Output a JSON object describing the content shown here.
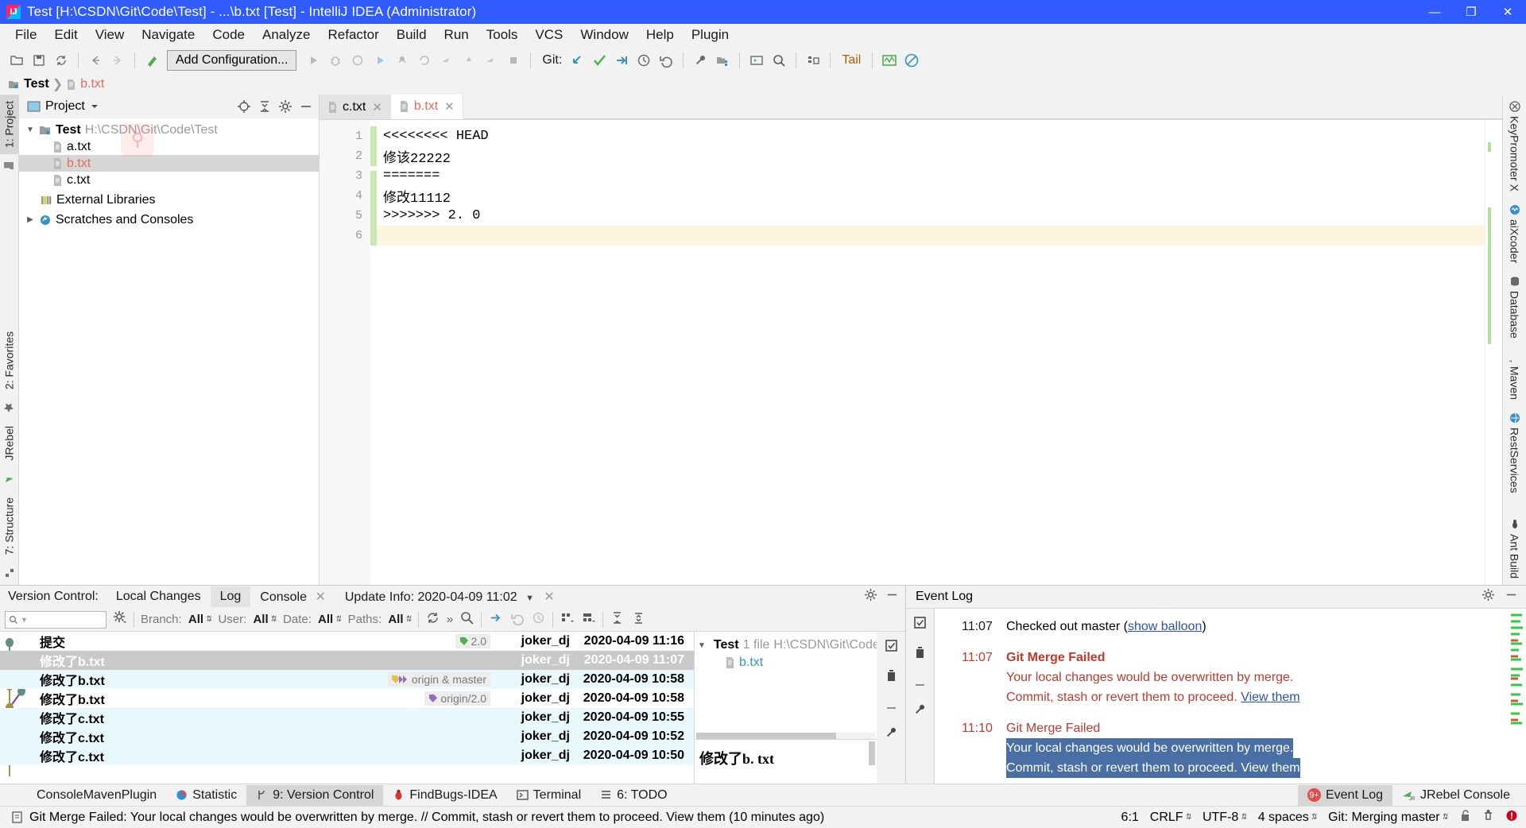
{
  "window": {
    "title": "Test [H:\\CSDN\\Git\\Code\\Test] - ...\\b.txt [Test] - IntelliJ IDEA (Administrator)",
    "minimize": "—",
    "maximize": "❐",
    "close": "✕"
  },
  "menu": [
    "File",
    "Edit",
    "View",
    "Navigate",
    "Code",
    "Analyze",
    "Refactor",
    "Build",
    "Run",
    "Tools",
    "VCS",
    "Window",
    "Help",
    "Plugin"
  ],
  "toolbar": {
    "add_configuration": "Add Configuration...",
    "git_label": "Git:",
    "tail_label": "Tail"
  },
  "breadcrumb": {
    "project": "Test",
    "file": "b.txt"
  },
  "left_strip": [
    "1: Project",
    "2: Favorites",
    "JRebel",
    "7: Structure"
  ],
  "right_strip": [
    "KeyPromoter X",
    "aiXcoder",
    "Database",
    "Maven",
    "RestServices",
    "Ant Build"
  ],
  "project_pane": {
    "title": "Project",
    "tree": [
      {
        "label": "Test",
        "path": "H:\\CSDN\\Git\\Code\\Test",
        "depth": 0,
        "type": "folder",
        "expanded": true,
        "selected": false
      },
      {
        "label": "a.txt",
        "path": "",
        "depth": 1,
        "type": "file",
        "selected": false
      },
      {
        "label": "b.txt",
        "path": "",
        "depth": 1,
        "type": "file",
        "selected": true,
        "modified": true
      },
      {
        "label": "c.txt",
        "path": "",
        "depth": 1,
        "type": "file",
        "selected": false
      },
      {
        "label": "External Libraries",
        "path": "",
        "depth": 0,
        "type": "library",
        "selected": false
      },
      {
        "label": "Scratches and Consoles",
        "path": "",
        "depth": 0,
        "type": "scratch",
        "selected": false
      }
    ]
  },
  "editor": {
    "tabs": [
      {
        "label": "c.txt",
        "active": false,
        "modified": false
      },
      {
        "label": "b.txt",
        "active": true,
        "modified": true
      }
    ],
    "lines": [
      {
        "n": "1",
        "text": "<<<<<<<< HEAD"
      },
      {
        "n": "2",
        "text": "修该22222"
      },
      {
        "n": "3",
        "text": "======="
      },
      {
        "n": "4",
        "text": "修改11112"
      },
      {
        "n": "5",
        "text": ">>>>>>> 2. 0"
      },
      {
        "n": "6",
        "text": ""
      }
    ]
  },
  "version_control": {
    "label": "Version Control:",
    "tabs": [
      {
        "label": "Local Changes",
        "selected": false,
        "closable": false
      },
      {
        "label": "Log",
        "selected": true,
        "closable": false
      },
      {
        "label": "Console",
        "selected": false,
        "closable": true
      }
    ],
    "update_info": "Update Info: 2020-04-09 11:02",
    "search_placeholder": "",
    "filters": [
      {
        "name": "Branch:",
        "value": "All"
      },
      {
        "name": "User:",
        "value": "All"
      },
      {
        "name": "Date:",
        "value": "All"
      },
      {
        "name": "Paths:",
        "value": "All"
      }
    ],
    "commits": [
      {
        "subject": "提交",
        "tag": "2.0",
        "tag_kind": "tag",
        "author": "joker_dj",
        "date": "2020-04-09 11:16",
        "state": "normal"
      },
      {
        "subject": "修改了b.txt",
        "tag": "",
        "tag_kind": "",
        "author": "joker_dj",
        "date": "2020-04-09 11:07",
        "state": "selected"
      },
      {
        "subject": "修改了b.txt",
        "tag": "origin & master",
        "tag_kind": "branch",
        "author": "joker_dj",
        "date": "2020-04-09 10:58",
        "state": "alt"
      },
      {
        "subject": "修改了b.txt",
        "tag": "origin/2.0",
        "tag_kind": "remote",
        "author": "joker_dj",
        "date": "2020-04-09 10:58",
        "state": "normal"
      },
      {
        "subject": "修改了c.txt",
        "tag": "",
        "tag_kind": "",
        "author": "joker_dj",
        "date": "2020-04-09 10:55",
        "state": "alt"
      },
      {
        "subject": "修改了c.txt",
        "tag": "",
        "tag_kind": "",
        "author": "joker_dj",
        "date": "2020-04-09 10:52",
        "state": "alt"
      },
      {
        "subject": "修改了c.txt",
        "tag": "",
        "tag_kind": "",
        "author": "joker_dj",
        "date": "2020-04-09 10:50",
        "state": "alt"
      }
    ],
    "detail": {
      "root_label": "Test",
      "root_count": "1 file",
      "root_path": "H:\\CSDN\\Git\\Code\\T",
      "file": "b.txt",
      "message": "修改了b. txt"
    }
  },
  "event_log": {
    "title": "Event Log",
    "entries": [
      {
        "time": "11:07",
        "time_color": "normal",
        "title": "Checked out master (",
        "title_bold": false,
        "link": "show balloon",
        "title_suffix": ")",
        "lines": []
      },
      {
        "time": "11:07",
        "time_color": "red",
        "title": "Git Merge Failed",
        "title_bold": true,
        "link": "",
        "title_suffix": "",
        "lines": [
          {
            "text": "Your local changes would be overwritten by merge.",
            "highlighted": false,
            "link": ""
          },
          {
            "text": "Commit, stash or revert them to proceed. ",
            "highlighted": false,
            "link": "View them"
          }
        ]
      },
      {
        "time": "11:10",
        "time_color": "red",
        "title": "Git Merge Failed",
        "title_bold": false,
        "link": "",
        "title_suffix": "",
        "lines": [
          {
            "text": "Your local changes would be overwritten by merge.",
            "highlighted": true,
            "link": ""
          },
          {
            "text": "Commit, stash or revert them to proceed. View them",
            "highlighted": true,
            "link": ""
          }
        ]
      }
    ]
  },
  "tool_buttons": {
    "left": [
      {
        "label": "ConsoleMavenPlugin",
        "icon": "none",
        "selected": false
      },
      {
        "label": "Statistic",
        "icon": "statistic-icon",
        "selected": false
      },
      {
        "label": "9: Version Control",
        "icon": "branch-icon",
        "selected": true
      },
      {
        "label": "FindBugs-IDEA",
        "icon": "bug-icon",
        "selected": false
      },
      {
        "label": "Terminal",
        "icon": "terminal-icon",
        "selected": false
      },
      {
        "label": "6: TODO",
        "icon": "todo-icon",
        "selected": false
      }
    ],
    "right": [
      {
        "label": "Event Log",
        "icon": "event-badge",
        "badge": "9+",
        "selected": true
      },
      {
        "label": "JRebel Console",
        "icon": "jrebel-icon",
        "badge": "",
        "selected": false
      }
    ]
  },
  "status_bar": {
    "message": "Git Merge Failed: Your local changes would be overwritten by merge. // Commit, stash or revert them to proceed. View them (10 minutes ago)",
    "caret": "6:1",
    "line_separator": "CRLF",
    "encoding": "UTF-8",
    "indent": "4 spaces",
    "branch": "Git: Merging master"
  },
  "colors": {
    "title_bg": "#2f5bff",
    "accent_blue": "#3592c4",
    "error_red": "#c0392b",
    "selection_blue": "#4a6fa5",
    "conflict_yellow": "#fcf6e0",
    "green_change": "#c9e6b4"
  }
}
